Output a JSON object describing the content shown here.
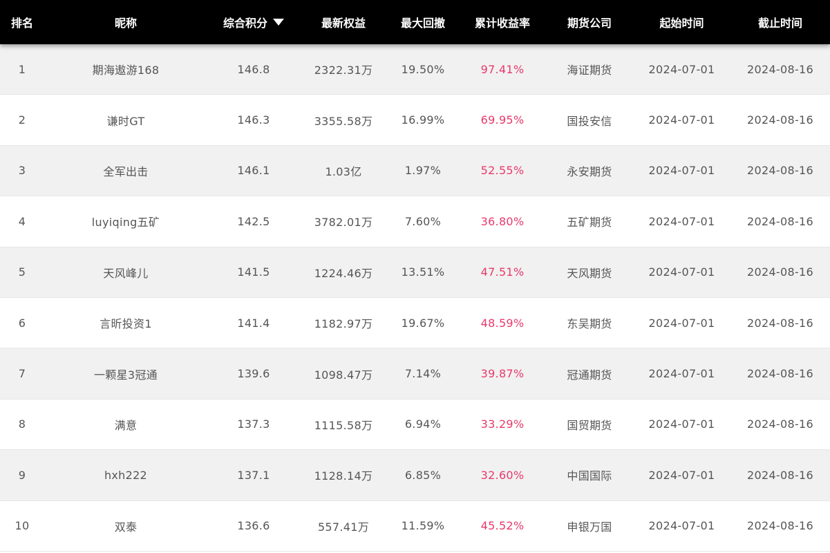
{
  "header": {
    "rank": "排名",
    "nickname": "昵称",
    "score": "综合积分",
    "equity": "最新权益",
    "drawdown": "最大回撤",
    "return": "累计收益率",
    "company": "期货公司",
    "start": "起始时间",
    "end": "截止时间",
    "sort_icon": "caret-down-icon"
  },
  "colors": {
    "header_bg": "#000000",
    "odd_row_bg": "#f1f1f1",
    "return_text": "#e8396b"
  },
  "rows": [
    {
      "rank": "1",
      "nickname": "期海遨游168",
      "score": "146.8",
      "equity": "2322.31万",
      "drawdown": "19.50%",
      "return": "97.41%",
      "company": "海证期货",
      "start": "2024-07-01",
      "end": "2024-08-16"
    },
    {
      "rank": "2",
      "nickname": "谦时GT",
      "score": "146.3",
      "equity": "3355.58万",
      "drawdown": "16.99%",
      "return": "69.95%",
      "company": "国投安信",
      "start": "2024-07-01",
      "end": "2024-08-16"
    },
    {
      "rank": "3",
      "nickname": "全军出击",
      "score": "146.1",
      "equity": "1.03亿",
      "drawdown": "1.97%",
      "return": "52.55%",
      "company": "永安期货",
      "start": "2024-07-01",
      "end": "2024-08-16"
    },
    {
      "rank": "4",
      "nickname": "luyiqing五矿",
      "score": "142.5",
      "equity": "3782.01万",
      "drawdown": "7.60%",
      "return": "36.80%",
      "company": "五矿期货",
      "start": "2024-07-01",
      "end": "2024-08-16"
    },
    {
      "rank": "5",
      "nickname": "天风峰儿",
      "score": "141.5",
      "equity": "1224.46万",
      "drawdown": "13.51%",
      "return": "47.51%",
      "company": "天风期货",
      "start": "2024-07-01",
      "end": "2024-08-16"
    },
    {
      "rank": "6",
      "nickname": "言昕投资1",
      "score": "141.4",
      "equity": "1182.97万",
      "drawdown": "19.67%",
      "return": "48.59%",
      "company": "东吴期货",
      "start": "2024-07-01",
      "end": "2024-08-16"
    },
    {
      "rank": "7",
      "nickname": "一颗星3冠通",
      "score": "139.6",
      "equity": "1098.47万",
      "drawdown": "7.14%",
      "return": "39.87%",
      "company": "冠通期货",
      "start": "2024-07-01",
      "end": "2024-08-16"
    },
    {
      "rank": "8",
      "nickname": "满意",
      "score": "137.3",
      "equity": "1115.58万",
      "drawdown": "6.94%",
      "return": "33.29%",
      "company": "国贸期货",
      "start": "2024-07-01",
      "end": "2024-08-16"
    },
    {
      "rank": "9",
      "nickname": "hxh222",
      "score": "137.1",
      "equity": "1128.14万",
      "drawdown": "6.85%",
      "return": "32.60%",
      "company": "中国国际",
      "start": "2024-07-01",
      "end": "2024-08-16"
    },
    {
      "rank": "10",
      "nickname": "双泰",
      "score": "136.6",
      "equity": "557.41万",
      "drawdown": "11.59%",
      "return": "45.52%",
      "company": "申银万国",
      "start": "2024-07-01",
      "end": "2024-08-16"
    }
  ]
}
